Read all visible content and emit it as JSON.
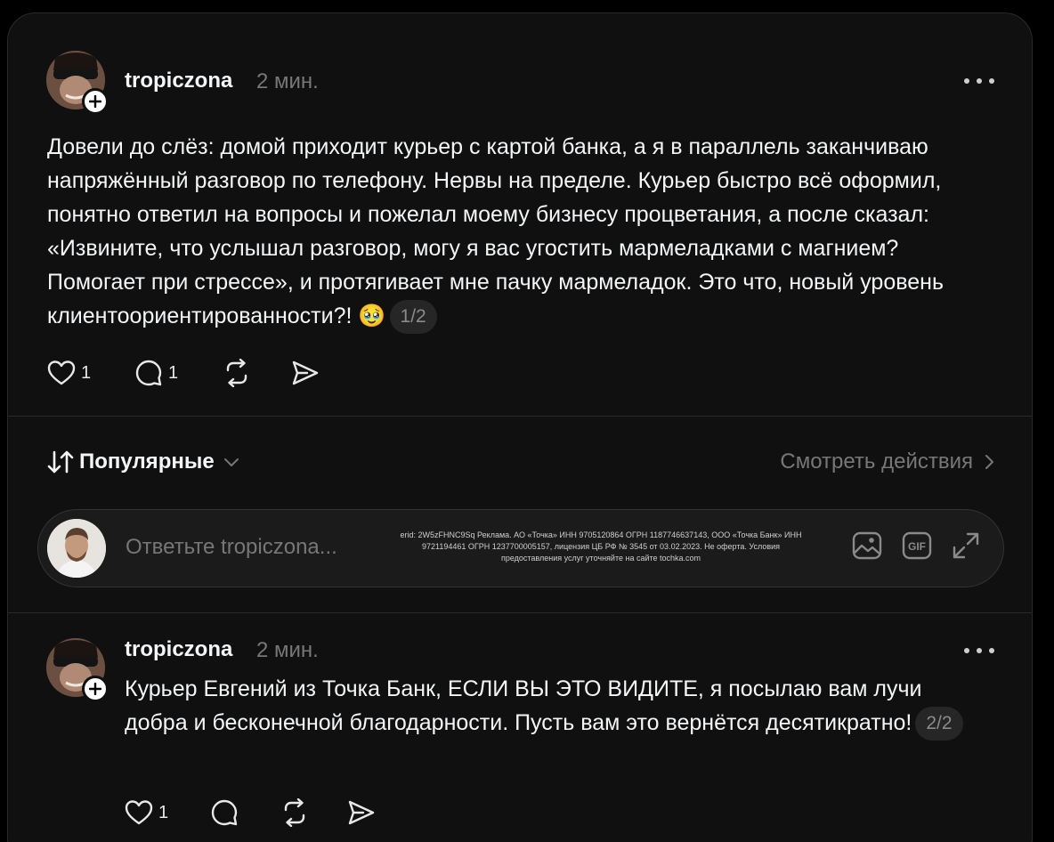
{
  "post1": {
    "username": "tropiczona",
    "time": "2 мин.",
    "text": "Довели до слёз: домой приходит курьер с картой банка, а я в параллель заканчиваю напряжённый разговор по телефону. Нервы на пределе. Курьер быстро всё оформил, понятно ответил на вопросы и пожелал моему бизнесу процветания, а после сказал: «Извините, что услышал разговор, могу я вас угостить мармеладками с магнием? Помогает при стрессе», и протягивает мне пачку мармеладок. Это что, новый уровень клиентоориентированности?! 🥹",
    "page": "1/2",
    "likes": "1",
    "replies": "1"
  },
  "sort": {
    "label": "Популярные",
    "view_activity": "Смотреть действия"
  },
  "reply_box": {
    "placeholder": "Ответьте tropiczona...",
    "ad_text": "erid: 2W5zFHNC9Sq Реклама. АО «Точка» ИНН 9705120864 ОГРН 1187746637143, ООО «Точка Банк» ИНН 9721194461 ОГРН 1237700005157, лицензия ЦБ РФ № 3545 от 03.02.2023. Не оферта. Условия предоставления услуг уточняйте на сайте tochka.com",
    "gif_label": "GIF"
  },
  "post2": {
    "username": "tropiczona",
    "time": "2 мин.",
    "text": "Курьер Евгений из Точка Банк, ЕСЛИ ВЫ ЭТО ВИДИТЕ, я посылаю вам лучи добра и бесконечной благодарности. Пусть вам это вернётся десятикратно!",
    "page": "2/2",
    "likes": "1"
  },
  "icons": [
    "plus-icon",
    "more-icon",
    "heart-icon",
    "comment-icon",
    "repost-icon",
    "share-icon",
    "sort-icon",
    "chevron-down-icon",
    "chevron-right-icon",
    "image-icon",
    "gif-icon",
    "expand-icon"
  ]
}
